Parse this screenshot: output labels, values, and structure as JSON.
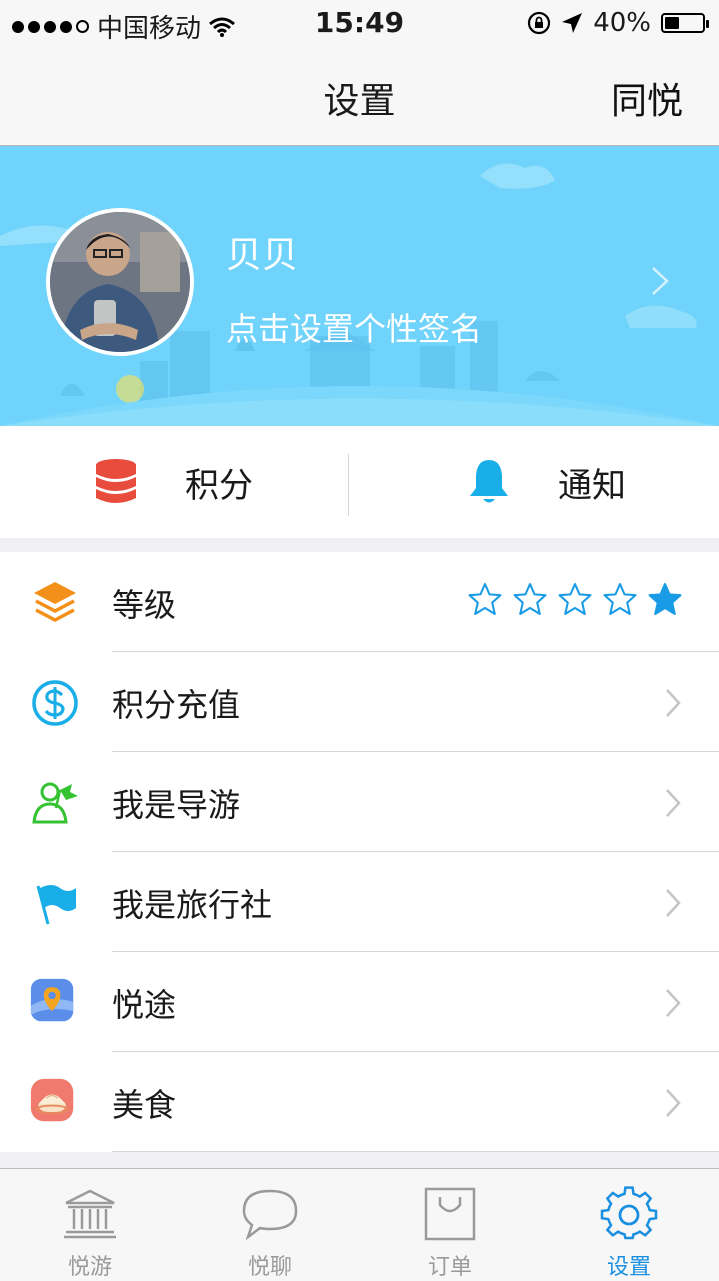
{
  "status_bar": {
    "carrier": "中国移动",
    "time": "15:49",
    "battery": "40%",
    "battery_level": 0.4
  },
  "nav": {
    "title": "设置",
    "right_label": "同悦"
  },
  "profile": {
    "name": "贝贝",
    "signature": "点击设置个性签名"
  },
  "quick": {
    "points_label": "积分",
    "notify_label": "通知"
  },
  "menu": {
    "level": {
      "label": "等级",
      "rating": 1,
      "max_rating": 5
    },
    "items": [
      {
        "label": "积分充值",
        "icon": "dollar-circle-icon"
      },
      {
        "label": "我是导游",
        "icon": "guide-icon"
      },
      {
        "label": "我是旅行社",
        "icon": "flag-icon"
      },
      {
        "label": "悦途",
        "icon": "map-pin-app-icon"
      },
      {
        "label": "美食",
        "icon": "food-app-icon"
      }
    ]
  },
  "tabs": [
    {
      "label": "悦游",
      "icon": "museum-icon",
      "active": false
    },
    {
      "label": "悦聊",
      "icon": "chat-bubble-icon",
      "active": false
    },
    {
      "label": "订单",
      "icon": "shopping-bag-icon",
      "active": false
    },
    {
      "label": "设置",
      "icon": "gear-icon",
      "active": true
    }
  ],
  "colors": {
    "accent": "#1a8fe0",
    "banner": "#6fd3fb",
    "star": "#1a9be6"
  }
}
